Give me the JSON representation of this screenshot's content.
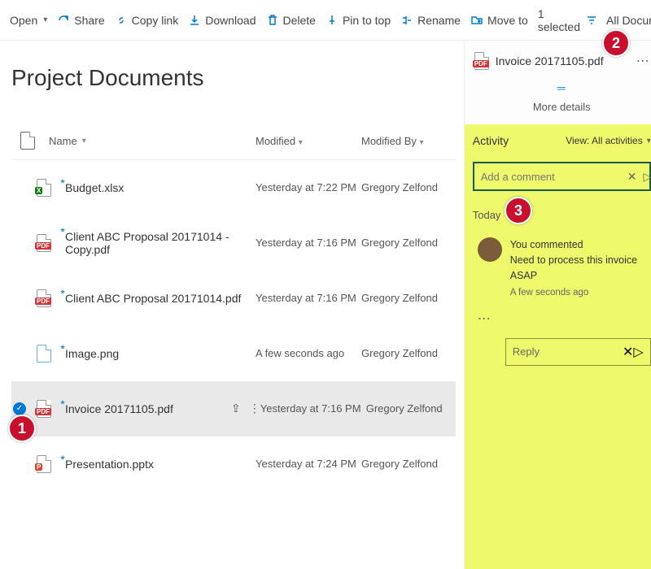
{
  "toolbar": {
    "open": "Open",
    "share": "Share",
    "copylink": "Copy link",
    "download": "Download",
    "delete": "Delete",
    "pin": "Pin to top",
    "rename": "Rename",
    "moveto": "Move to",
    "selected": "1 selected",
    "alldocs": "All Documents"
  },
  "page": {
    "title": "Project Documents"
  },
  "cols": {
    "name": "Name",
    "modified": "Modified",
    "modifiedby": "Modified By"
  },
  "rows": [
    {
      "name": "Budget.xlsx",
      "type": "xlsx",
      "modified": "Yesterday at 7:22 PM",
      "by": "Gregory Zelfond",
      "selected": false
    },
    {
      "name": "Client ABC Proposal 20171014 - Copy.pdf",
      "type": "pdf",
      "modified": "Yesterday at 7:16 PM",
      "by": "Gregory Zelfond",
      "selected": false
    },
    {
      "name": "Client ABC Proposal 20171014.pdf",
      "type": "pdf",
      "modified": "Yesterday at 7:16 PM",
      "by": "Gregory Zelfond",
      "selected": false
    },
    {
      "name": "Image.png",
      "type": "png",
      "modified": "A few seconds ago",
      "by": "Gregory Zelfond",
      "selected": false
    },
    {
      "name": "Invoice 20171105.pdf",
      "type": "pdf",
      "modified": "Yesterday at 7:16 PM",
      "by": "Gregory Zelfond",
      "selected": true
    },
    {
      "name": "Presentation.pptx",
      "type": "pptx",
      "modified": "Yesterday at 7:24 PM",
      "by": "Gregory Zelfond",
      "selected": false
    }
  ],
  "details": {
    "filename": "Invoice 20171105.pdf",
    "moredetails": "More details",
    "activity_label": "Activity",
    "view_label": "View: All activities",
    "comment_placeholder": "Add a comment",
    "today": "Today",
    "entry_head": "You commented",
    "entry_body": "Need to process this invoice ASAP",
    "entry_ago": "A few seconds ago",
    "reply_placeholder": "Reply"
  },
  "badges": {
    "one": "1",
    "two": "2",
    "three": "3"
  }
}
